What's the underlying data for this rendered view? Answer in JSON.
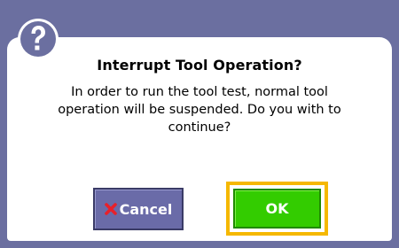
{
  "dialog": {
    "title": "Interrupt Tool Operation?",
    "message": "In order to run the tool test, normal tool operation will be suspended. Do you with to continue?",
    "icon": "question-icon",
    "colors": {
      "frame": "#6b6fa0",
      "cancel_bg": "#6a6ba8",
      "ok_bg": "#33cc00",
      "focus_ring": "#f5b800",
      "cancel_icon": "#e8202a"
    }
  },
  "buttons": {
    "cancel_label": "Cancel",
    "ok_label": "OK"
  }
}
